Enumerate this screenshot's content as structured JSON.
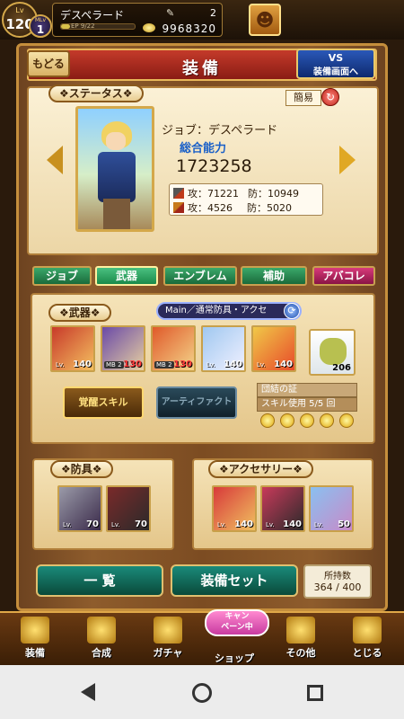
{
  "player": {
    "lv_label": "Lv",
    "level": "120",
    "mlv_label": "MLv",
    "mlv": "1",
    "name": "デスペラード",
    "ep_text": "EP 9/22",
    "gems": "2",
    "gold": "9968320"
  },
  "header": {
    "title": "装備",
    "back_label": "もどる",
    "vs_line1": "VS",
    "vs_line2": "装備画面へ"
  },
  "status": {
    "section_label": "ステータス",
    "mode_label": "簡易",
    "job_line": "ジョブ：デスペラード",
    "power_label": "総合能力",
    "power_value": "1723258",
    "phys_atk": "攻：71221",
    "phys_def": "防：10949",
    "mag_atk": "攻：4526",
    "mag_def": "防：5020"
  },
  "tabs": [
    {
      "label": "ジョブ"
    },
    {
      "label": "武器"
    },
    {
      "label": "エンブレム"
    },
    {
      "label": "補助"
    },
    {
      "label": "アバコレ"
    }
  ],
  "weapons": {
    "section_label": "武器",
    "main_label": "Main／通常防具・アクセ",
    "slots": [
      {
        "level": "140",
        "mb": "",
        "lv_small": "Lv."
      },
      {
        "level": "130",
        "mb": "MB 2",
        "lv_small": ""
      },
      {
        "level": "130",
        "mb": "MB 2",
        "lv_small": ""
      },
      {
        "level": "140",
        "mb": "",
        "lv_small": "Lv."
      },
      {
        "level": "140",
        "mb": "",
        "lv_small": "Lv."
      }
    ],
    "bond_count": "206",
    "skill_button": "覚醒スキル",
    "artifact_button": "アーティファクト",
    "bond_title": "団結の証",
    "bond_usage": "スキル使用 5/5 回"
  },
  "armor": {
    "section_label": "防具",
    "slots": [
      {
        "level": "70",
        "lv_small": "Lv."
      },
      {
        "level": "70",
        "lv_small": "Lv."
      }
    ]
  },
  "accessory": {
    "section_label": "アクセサリー",
    "slots": [
      {
        "level": "140",
        "lv_small": "Lv."
      },
      {
        "level": "140",
        "lv_small": "Lv."
      },
      {
        "level": "50",
        "lv_small": "Lv."
      }
    ]
  },
  "actions": {
    "list_button": "一 覧",
    "set_button": "装備セット",
    "hold_label": "所持数",
    "hold_value": "364 / 400"
  },
  "nav": {
    "items": [
      {
        "label": "装備",
        "icon": "sword-shield-icon"
      },
      {
        "label": "合成",
        "icon": "hammer-icon"
      },
      {
        "label": "ガチャ",
        "icon": "card-icon"
      },
      {
        "label": "ショップ",
        "icon": "shop-icon"
      },
      {
        "label": "その他",
        "icon": "gear-icon"
      },
      {
        "label": "とじる",
        "icon": "close-icon"
      }
    ],
    "campaign_line1": "キャン",
    "campaign_line2": "ペーン中"
  },
  "colors": {
    "accent_red": "#c43a2a",
    "tab_green": "#3aa86a",
    "tab_pink": "#d83a7a",
    "power_blue": "#1a60c8"
  }
}
